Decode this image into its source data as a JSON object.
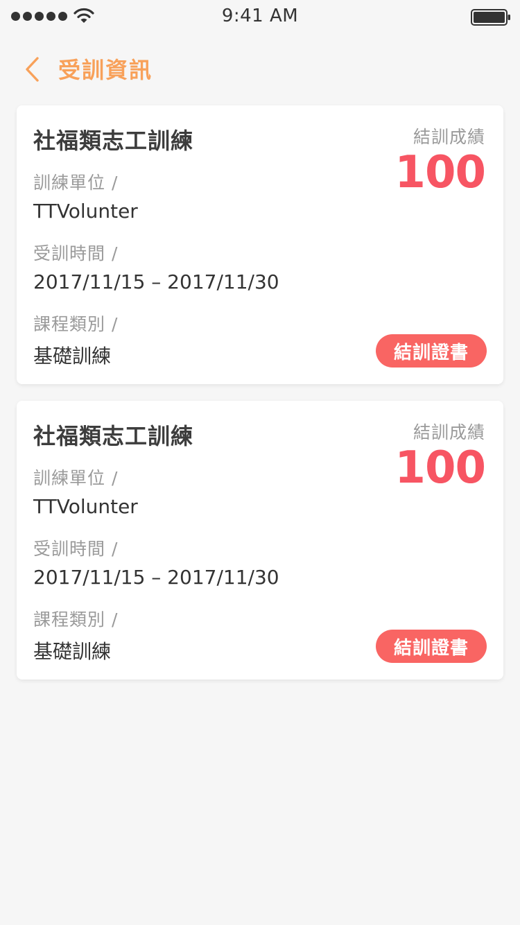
{
  "status_bar": {
    "time": "9:41 AM",
    "signal_icon": "signal-dots-icon",
    "wifi_icon": "wifi-icon",
    "battery_icon": "battery-icon"
  },
  "nav": {
    "back_icon": "chevron-left-icon",
    "title": "受訓資訊",
    "accent_color": "#f8a15a"
  },
  "cards": [
    {
      "title": "社福類志工訓練",
      "unit_label": "訓練單位 /",
      "unit_value": "TTVolunter",
      "period_label": "受訓時間 /",
      "period_value": "2017/11/15 – 2017/11/30",
      "category_label": "課程類別 /",
      "category_value": "基礎訓練",
      "score_label": "結訓成績",
      "score_value": "100",
      "certificate_button": "結訓證書"
    },
    {
      "title": "社福類志工訓練",
      "unit_label": "訓練單位 /",
      "unit_value": "TTVolunter",
      "period_label": "受訓時間 /",
      "period_value": "2017/11/15 – 2017/11/30",
      "category_label": "課程類別 /",
      "category_value": "基礎訓練",
      "score_label": "結訓成績",
      "score_value": "100",
      "certificate_button": "結訓證書"
    }
  ],
  "colors": {
    "score": "#f75563",
    "button": "#f96563",
    "background": "#f6f6f6"
  }
}
